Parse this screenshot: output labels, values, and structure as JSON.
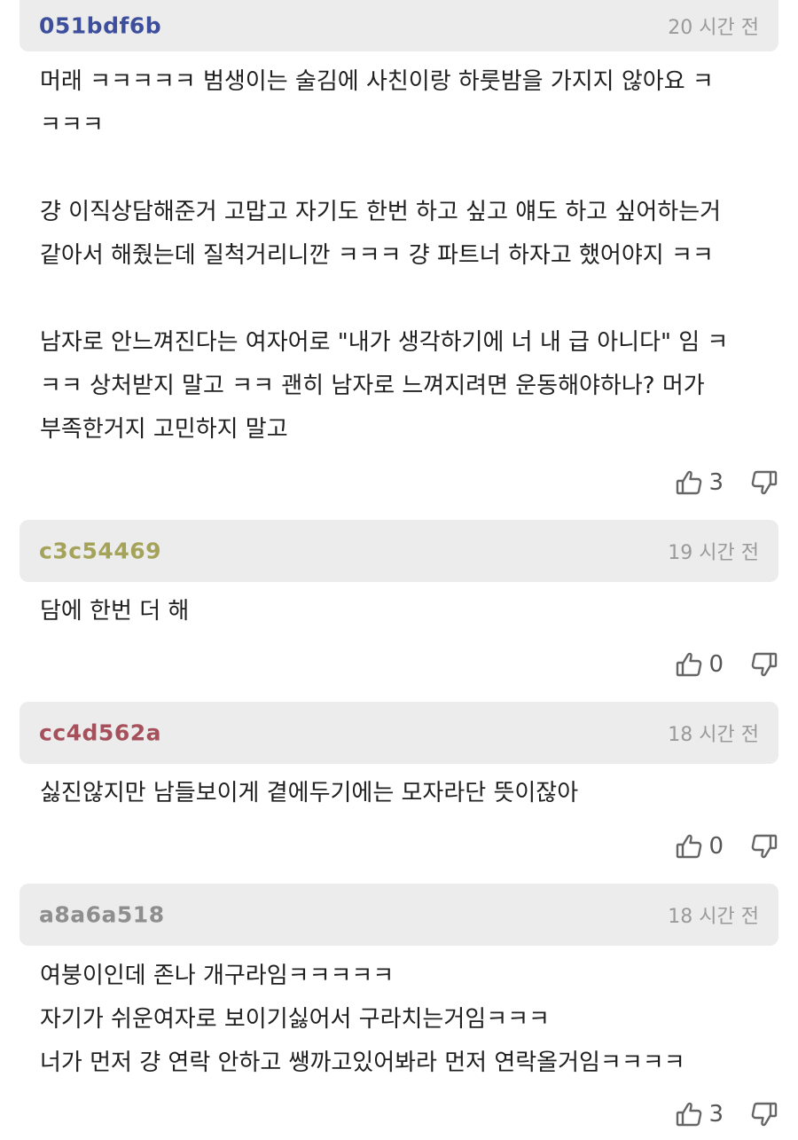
{
  "comments": [
    {
      "author": "051bdf6b",
      "author_color": "#3d4f9c",
      "time": "20 시간 전",
      "lines": [
        "머래 ㅋㅋㅋㅋㅋ 범생이는 술김에 사친이랑 하룻밤을 가지지 않아요 ㅋ",
        "ㅋㅋㅋ",
        "",
        "걍 이직상담해준거 고맙고 자기도 한번 하고 싶고 얘도 하고 싶어하는거",
        "같아서 해줬는데 질척거리니깐 ㅋㅋㅋ 걍 파트너 하자고 했어야지 ㅋㅋ",
        "",
        "남자로 안느껴진다는 여자어로 \"내가 생각하기에 너 내 급 아니다\" 임 ㅋ",
        "ㅋㅋ 상처받지 말고 ㅋㅋ 괜히 남자로 느껴지려면 운동해야하나? 머가",
        "부족한거지 고민하지 말고"
      ],
      "upvotes": "3"
    },
    {
      "author": "c3c54469",
      "author_color": "#a5a35a",
      "time": "19 시간 전",
      "lines": [
        "담에 한번 더 해"
      ],
      "upvotes": "0"
    },
    {
      "author": "cc4d562a",
      "author_color": "#a5505b",
      "time": "18 시간 전",
      "lines": [
        "싫진않지만 남들보이게 곁에두기에는 모자라단 뜻이잖아"
      ],
      "upvotes": "0"
    },
    {
      "author": "a8a6a518",
      "author_color": "#8e8e8e",
      "time": "18 시간 전",
      "lines": [
        "여붕이인데 존나 개구라임ㅋㅋㅋㅋㅋ",
        "자기가 쉬운여자로 보이기싫어서 구라치는거임ㅋㅋㅋ",
        "너가 먼저 걍 연락 안하고 쌩까고있어봐라 먼저 연락올거임ㅋㅋㅋㅋ"
      ],
      "upvotes": "3"
    }
  ],
  "icons": {
    "upvote": "thumbs-up-icon",
    "downvote": "thumbs-down-icon"
  }
}
